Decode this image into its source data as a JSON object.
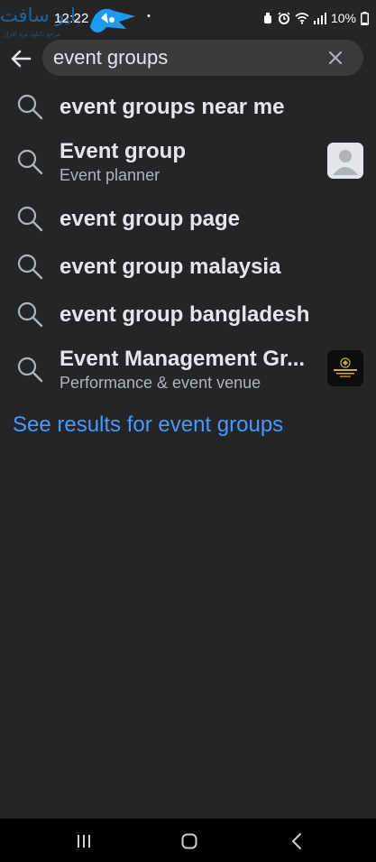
{
  "status_bar": {
    "time": "12:22",
    "dot": "•",
    "battery": "10%",
    "icons": [
      "alarm-icon",
      "clock-icon",
      "wifi-icon",
      "signal-icon"
    ]
  },
  "watermark": {
    "text": "بایو سافت",
    "icon": "watermark-logo"
  },
  "search": {
    "query": "event groups",
    "back_icon": "back-arrow-icon",
    "clear_icon": "close-icon"
  },
  "suggestions": [
    {
      "title": "event groups near me"
    },
    {
      "title": "Event group",
      "subtitle": "Event planner",
      "thumbnail": "default-avatar"
    },
    {
      "title": "event group page"
    },
    {
      "title": "event group malaysia"
    },
    {
      "title": "event group bangladesh"
    },
    {
      "title": "Event Management Gr...",
      "subtitle": "Performance & event venue",
      "thumbnail": "page-logo"
    }
  ],
  "see_results_label": "See results for event groups",
  "nav": [
    "recent-apps-icon",
    "home-icon",
    "back-icon"
  ],
  "colors": {
    "background": "#242527",
    "search_field": "#3a3b3c",
    "primary_text": "#e4e6eb",
    "secondary_text": "#b0b3b8",
    "link": "#4599ff",
    "nav_bar": "#000000"
  }
}
